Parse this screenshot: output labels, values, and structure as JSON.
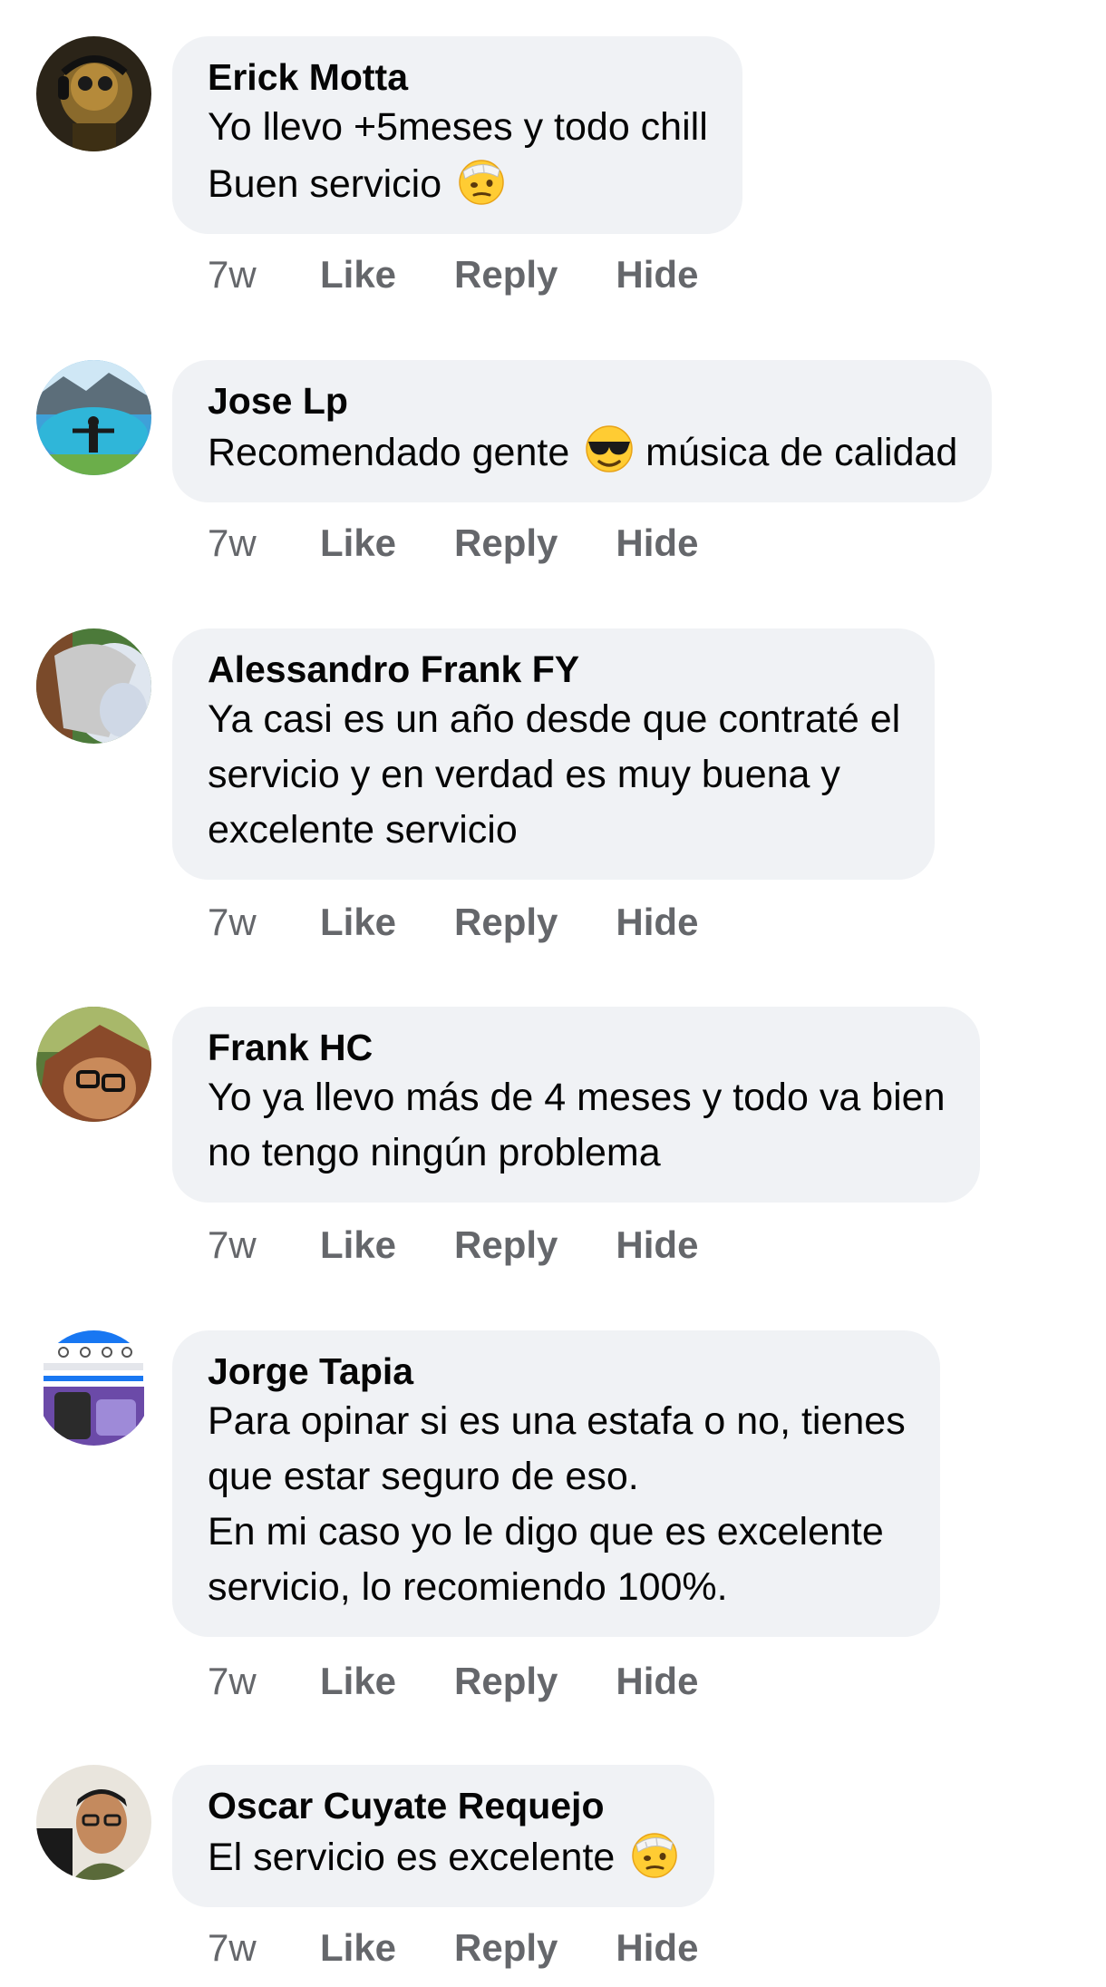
{
  "comments": [
    {
      "author": "Erick Motta",
      "text": "Yo llevo +5meses y todo chill\nBuen servicio",
      "emoji": "face-with-bandage-emoji",
      "time": "7w",
      "like": "Like",
      "reply": "Reply",
      "hide": "Hide"
    },
    {
      "author": "Jose Lp",
      "text_before": "Recomendado gente",
      "emoji": "smiling-face-with-sunglasses-emoji",
      "text_after": "música de calidad",
      "time": "7w",
      "like": "Like",
      "reply": "Reply",
      "hide": "Hide"
    },
    {
      "author": "Alessandro Frank FY",
      "text": "Ya casi es un año desde que contraté el\nservicio y en verdad es muy buena y\nexcelente servicio",
      "time": "7w",
      "like": "Like",
      "reply": "Reply",
      "hide": "Hide"
    },
    {
      "author": "Frank HC",
      "text": "Yo ya llevo más de 4 meses y todo va bien\nno tengo ningún problema",
      "time": "7w",
      "like": "Like",
      "reply": "Reply",
      "hide": "Hide"
    },
    {
      "author": "Jorge Tapia",
      "text": "Para opinar si es una estafa o no, tienes\nque estar seguro de eso.\nEn mi caso yo le digo que es excelente\nservicio, lo recomiendo 100%.",
      "time": "7w",
      "like": "Like",
      "reply": "Reply",
      "hide": "Hide"
    },
    {
      "author": "Oscar Cuyate Requejo",
      "text": "El servicio es excelente",
      "emoji": "face-with-bandage-emoji",
      "time": "7w",
      "like": "Like",
      "reply": "Reply",
      "hide": "Hide"
    }
  ],
  "colors": {
    "bubble": "#f0f2f5",
    "text": "#050505",
    "secondary": "#65676b"
  }
}
